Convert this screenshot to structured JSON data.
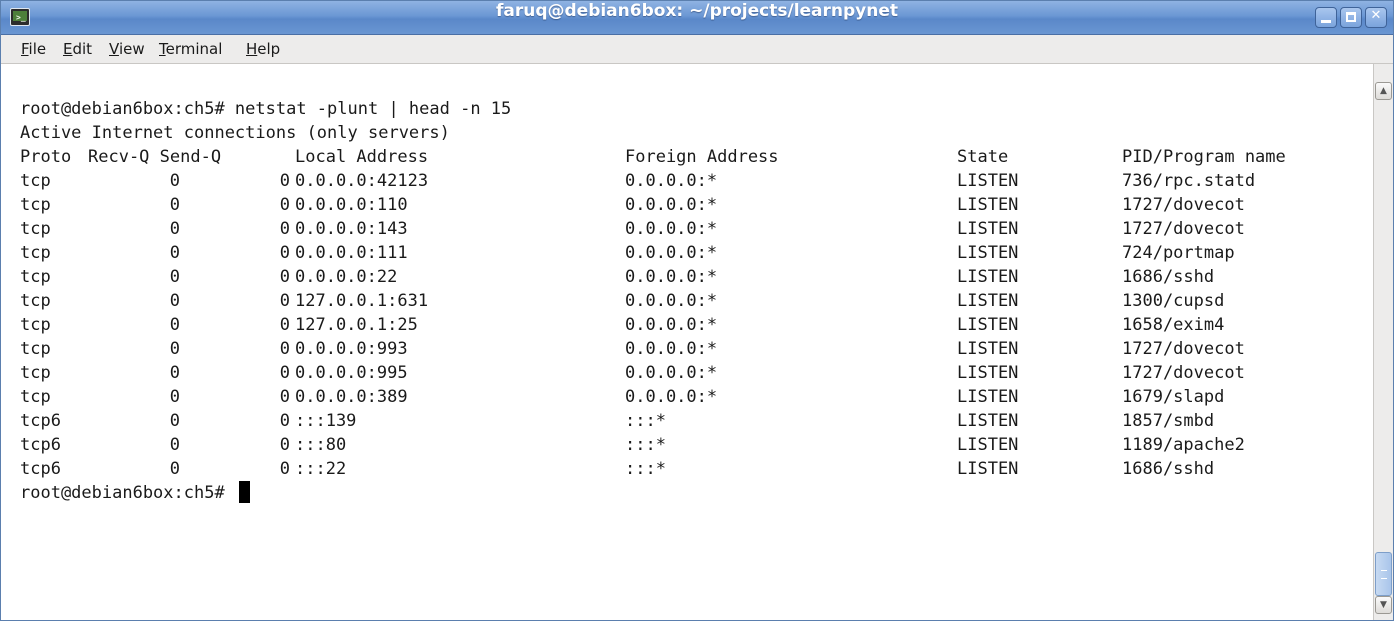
{
  "window": {
    "title": "faruq@debian6box: ~/projects/learnpynet",
    "app_icon": "terminal-icon",
    "controls": {
      "minimize_icon": "minimize-icon",
      "maximize_icon": "maximize-icon",
      "close_icon": "close-icon",
      "close_glyph": "✕"
    },
    "title_color": "#6b97d4"
  },
  "menubar": {
    "file": {
      "mnemonic": "F",
      "rest": "ile"
    },
    "edit": {
      "mnemonic": "E",
      "rest": "dit"
    },
    "view": {
      "mnemonic": "V",
      "rest": "iew"
    },
    "terminal": {
      "mnemonic": "T",
      "rest": "erminal"
    },
    "help": {
      "mnemonic": "H",
      "rest": "elp"
    }
  },
  "terminal": {
    "command_line": "root@debian6box:ch5# netstat -plunt | head -n 15",
    "info_line": "Active Internet connections (only servers)",
    "headers": {
      "proto": "Proto",
      "recv_send": "Recv-Q Send-Q",
      "local": "Local Address",
      "foreign": "Foreign Address",
      "state": "State",
      "pid": "PID/Program name"
    },
    "rows": [
      {
        "proto": "tcp",
        "recv": "0",
        "send": "0",
        "local": "0.0.0.0:42123",
        "foreign": "0.0.0.0:*",
        "state": "LISTEN",
        "pid": "736/rpc.statd"
      },
      {
        "proto": "tcp",
        "recv": "0",
        "send": "0",
        "local": "0.0.0.0:110",
        "foreign": "0.0.0.0:*",
        "state": "LISTEN",
        "pid": "1727/dovecot"
      },
      {
        "proto": "tcp",
        "recv": "0",
        "send": "0",
        "local": "0.0.0.0:143",
        "foreign": "0.0.0.0:*",
        "state": "LISTEN",
        "pid": "1727/dovecot"
      },
      {
        "proto": "tcp",
        "recv": "0",
        "send": "0",
        "local": "0.0.0.0:111",
        "foreign": "0.0.0.0:*",
        "state": "LISTEN",
        "pid": "724/portmap"
      },
      {
        "proto": "tcp",
        "recv": "0",
        "send": "0",
        "local": "0.0.0.0:22",
        "foreign": "0.0.0.0:*",
        "state": "LISTEN",
        "pid": "1686/sshd"
      },
      {
        "proto": "tcp",
        "recv": "0",
        "send": "0",
        "local": "127.0.0.1:631",
        "foreign": "0.0.0.0:*",
        "state": "LISTEN",
        "pid": "1300/cupsd"
      },
      {
        "proto": "tcp",
        "recv": "0",
        "send": "0",
        "local": "127.0.0.1:25",
        "foreign": "0.0.0.0:*",
        "state": "LISTEN",
        "pid": "1658/exim4"
      },
      {
        "proto": "tcp",
        "recv": "0",
        "send": "0",
        "local": "0.0.0.0:993",
        "foreign": "0.0.0.0:*",
        "state": "LISTEN",
        "pid": "1727/dovecot"
      },
      {
        "proto": "tcp",
        "recv": "0",
        "send": "0",
        "local": "0.0.0.0:995",
        "foreign": "0.0.0.0:*",
        "state": "LISTEN",
        "pid": "1727/dovecot"
      },
      {
        "proto": "tcp",
        "recv": "0",
        "send": "0",
        "local": "0.0.0.0:389",
        "foreign": "0.0.0.0:*",
        "state": "LISTEN",
        "pid": "1679/slapd"
      },
      {
        "proto": "tcp6",
        "recv": "0",
        "send": "0",
        "local": ":::139",
        "foreign": ":::*",
        "state": "LISTEN",
        "pid": "1857/smbd"
      },
      {
        "proto": "tcp6",
        "recv": "0",
        "send": "0",
        "local": ":::80",
        "foreign": ":::*",
        "state": "LISTEN",
        "pid": "1189/apache2"
      },
      {
        "proto": "tcp6",
        "recv": "0",
        "send": "0",
        "local": ":::22",
        "foreign": ":::*",
        "state": "LISTEN",
        "pid": "1686/sshd"
      }
    ],
    "prompt_line": "root@debian6box:ch5# ",
    "background_color": "#ffffff",
    "text_color": "#1a1a1a"
  },
  "scrollbar": {
    "up_icon": "scroll-up-arrow-icon",
    "down_icon": "scroll-down-arrow-icon",
    "up_glyph": "▲",
    "down_glyph": "▼"
  }
}
